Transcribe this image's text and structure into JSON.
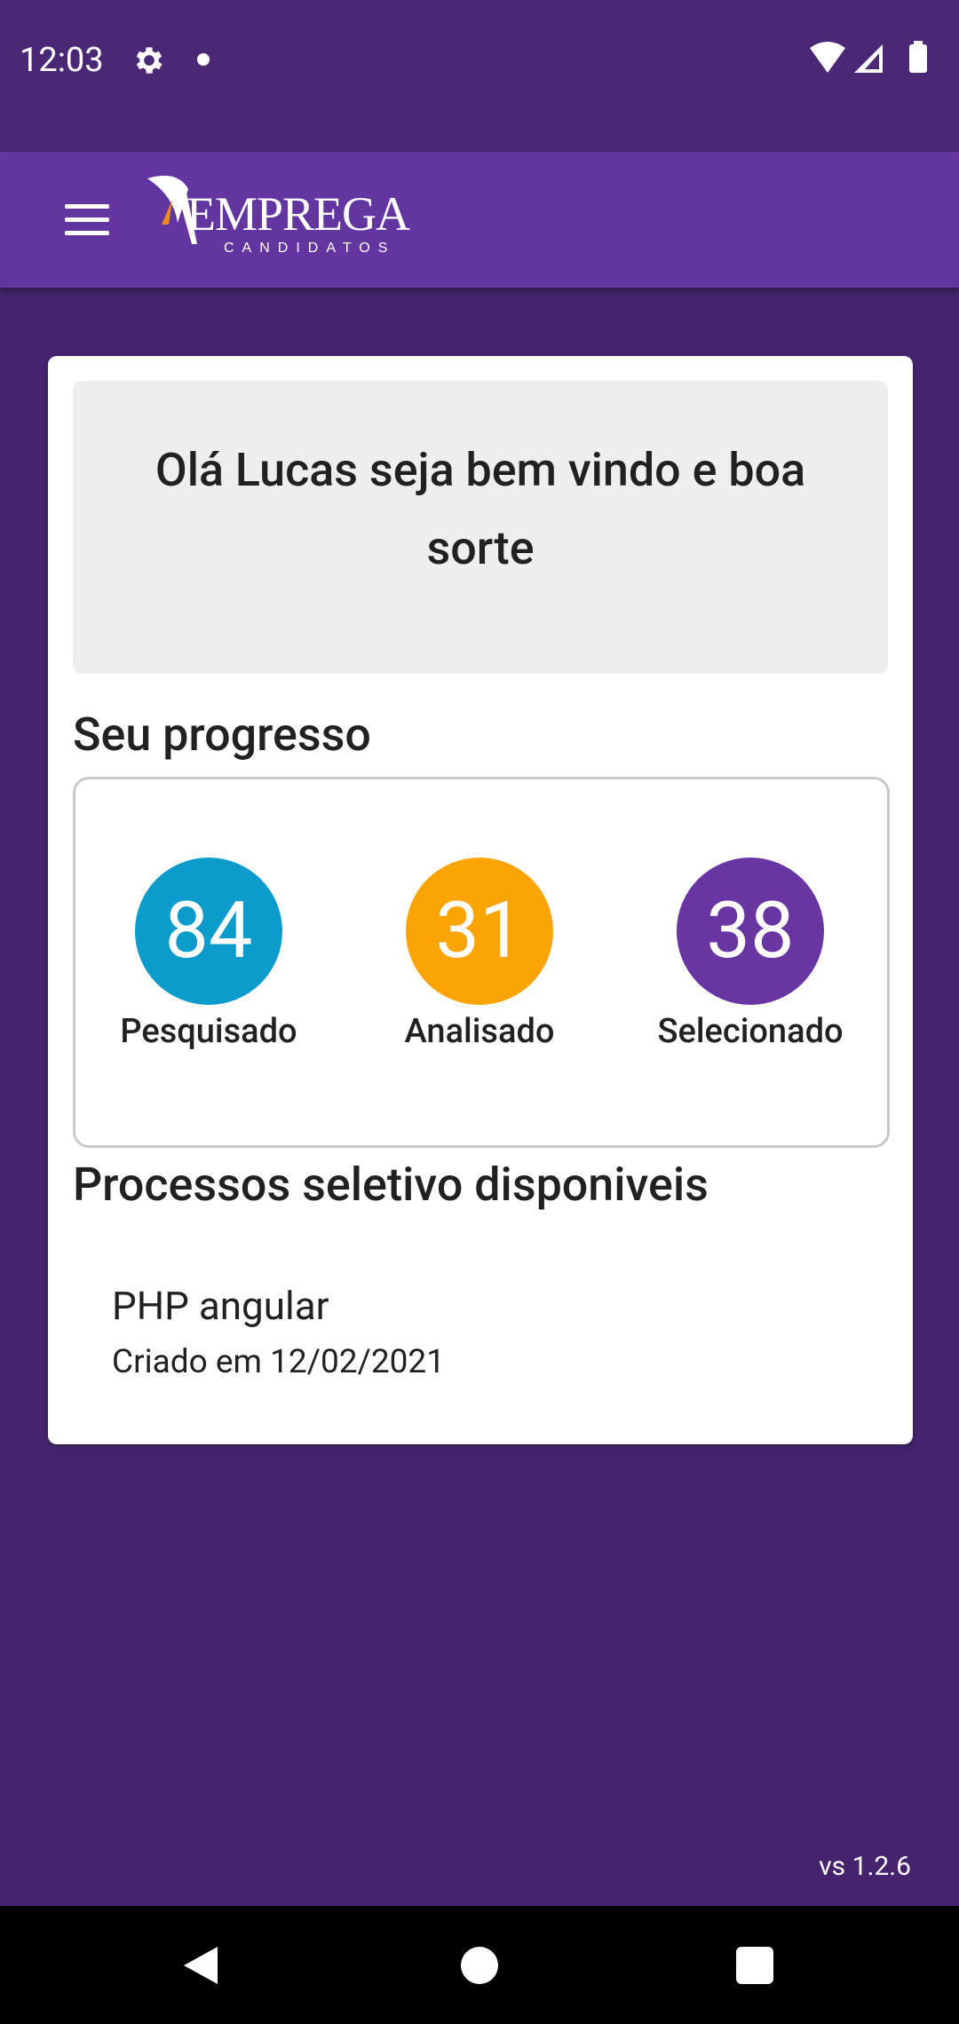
{
  "status_bar": {
    "time": "12:03",
    "icons": [
      "settings-icon",
      "notification-dot-icon",
      "wifi-icon",
      "signal-icon",
      "battery-icon"
    ]
  },
  "app_bar": {
    "menu_icon": "menu-icon",
    "logo_text": "EMPREGA",
    "logo_sub": "CANDIDATOS"
  },
  "welcome": {
    "message": "Olá Lucas seja bem vindo e boa sorte"
  },
  "progress": {
    "title": "Seu progresso",
    "stats": [
      {
        "value": "84",
        "label": "Pesquisado",
        "color": "#0c9ccc"
      },
      {
        "value": "31",
        "label": "Analisado",
        "color": "#fca403"
      },
      {
        "value": "38",
        "label": "Selecionado",
        "color": "#6835a3"
      }
    ]
  },
  "processes": {
    "title": "Processos seletivo disponiveis",
    "items": [
      {
        "name": "PHP angular",
        "created": "Criado em 12/02/2021"
      }
    ]
  },
  "version": "vs 1.2.6",
  "colors": {
    "background": "#45246d",
    "status_bar": "#4b2876",
    "app_bar": "#6335a0",
    "logo_accent": "#f08a24"
  },
  "nav_bar": {
    "icons": [
      "back-icon",
      "home-icon",
      "recent-apps-icon"
    ]
  }
}
